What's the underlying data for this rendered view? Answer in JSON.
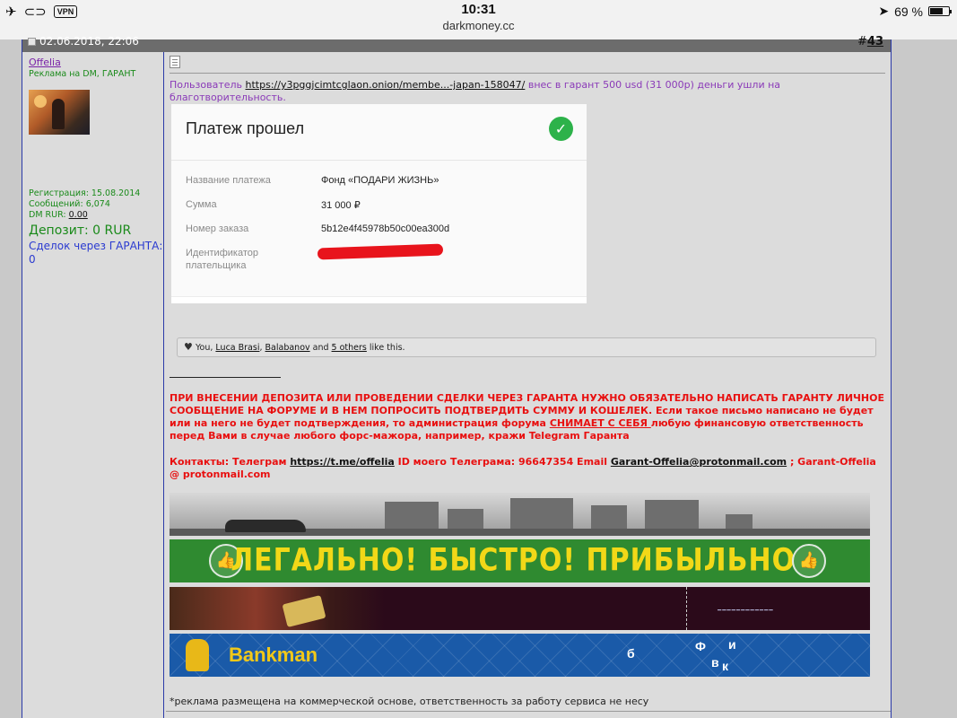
{
  "status_bar": {
    "vpn": "VPN",
    "time": "10:31",
    "url": "darkmoney.cc",
    "battery": "69 %",
    "battery_level": 0.69
  },
  "post": {
    "date": "02.06.2018, 22:06",
    "number_prefix": "#",
    "number": "43"
  },
  "user": {
    "name": "Offelia",
    "title": "Реклама на DM, ГАРАНТ",
    "registration": "Регистрация: 15.08.2014",
    "messages": "Сообщений: 6,074",
    "dm_rur_label": "DM RUR: ",
    "dm_rur_value": "0.00",
    "deposit": "Депозит: 0 RUR",
    "deals": "Сделок через ГАРАНТА: 0"
  },
  "intro": {
    "prefix": "Пользователь ",
    "link": "https://y3pggjcimtcglaon.onion/membe...-japan-158047/",
    "suffix": " внес в гарант 500 usd (31 000р) деньги ушли на благотворительность."
  },
  "payment": {
    "title": "Платеж прошел",
    "rows": [
      {
        "label": "Название платежа",
        "value": "Фонд «ПОДАРИ ЖИЗНЬ»"
      },
      {
        "label": "Сумма",
        "value": "31 000 ₽"
      },
      {
        "label": "Номер заказа",
        "value": "5b12e4f45978b50c00ea300d"
      },
      {
        "label": "Идентификатор плательщика",
        "value": ""
      }
    ]
  },
  "likes": {
    "you": "You, ",
    "user1": "Luca Brasi",
    "sep": ", ",
    "user2": "Balabanov",
    "and": " and ",
    "others": "5 others",
    "tail": " like this."
  },
  "warning": {
    "part1": "ПРИ ВНЕСЕНИИ ДЕПОЗИТА ИЛИ ПРОВЕДЕНИИ СДЕЛКИ ЧЕРЕЗ ГАРАНТА НУЖНО ОБЯЗАТЕЛЬНО НАПИСАТЬ ГАРАНТУ ЛИЧНОЕ СООБЩЕНИЕ НА ФОРУМЕ И В НЕМ ПОПРОСИТЬ ПОДТВЕРДИТЬ СУММУ И КОШЕЛЕК. Если такое письмо написано не будет или на него не будет подтверждения, то администрация форума ",
    "underlined": "СНИМАЕТ С СЕБЯ ",
    "part2": "любую финансовую ответственность перед Вами в случае любого форс-мажора, например, кражи Telegram Гаранта"
  },
  "contacts": {
    "label": "Контакты: Телеграм ",
    "telegram_link": "https://t.me/offelia",
    "id_label": " ID моего Телеграма: 96647354 Email ",
    "email": "Garant-Offelia@protonmail.com",
    "alt": " ; Garant-Offelia @ protonmail.com"
  },
  "banners": {
    "green_text": "ЛЕГАЛЬНО! БЫСТРО! ПРИБЫЛЬНО!",
    "bankman": "Bankman",
    "letters": [
      "б",
      "Ф",
      "и",
      "в",
      "к"
    ]
  },
  "disclaimer": "*реклама размещена на коммерческой основе, ответственность за работу сервиса не несу"
}
